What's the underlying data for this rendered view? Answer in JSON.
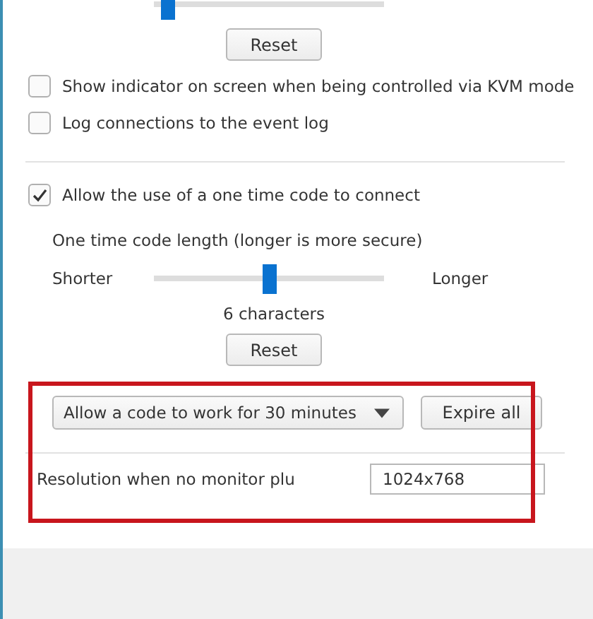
{
  "top_slider": {
    "level": 0.03
  },
  "top_reset": "Reset",
  "options": [
    {
      "label": "Show indicator on screen when being controlled via KVM mode",
      "checked": false
    },
    {
      "label": "Log connections to the event log",
      "checked": false
    }
  ],
  "one_time_code": {
    "label": "Allow the use of a one time code to connect",
    "checked": true
  },
  "code_length": {
    "title": "One time code length (longer is more secure)",
    "left_label": "Shorter",
    "right_label": "Longer",
    "level": 0.5,
    "reading": "6 characters"
  },
  "code_reset": "Reset",
  "code_duration": {
    "value": "Allow a code to work for 30 minutes"
  },
  "expire_button": "Expire all",
  "resolution": {
    "label": "Resolution when no monitor plu",
    "value": "1024x768"
  }
}
